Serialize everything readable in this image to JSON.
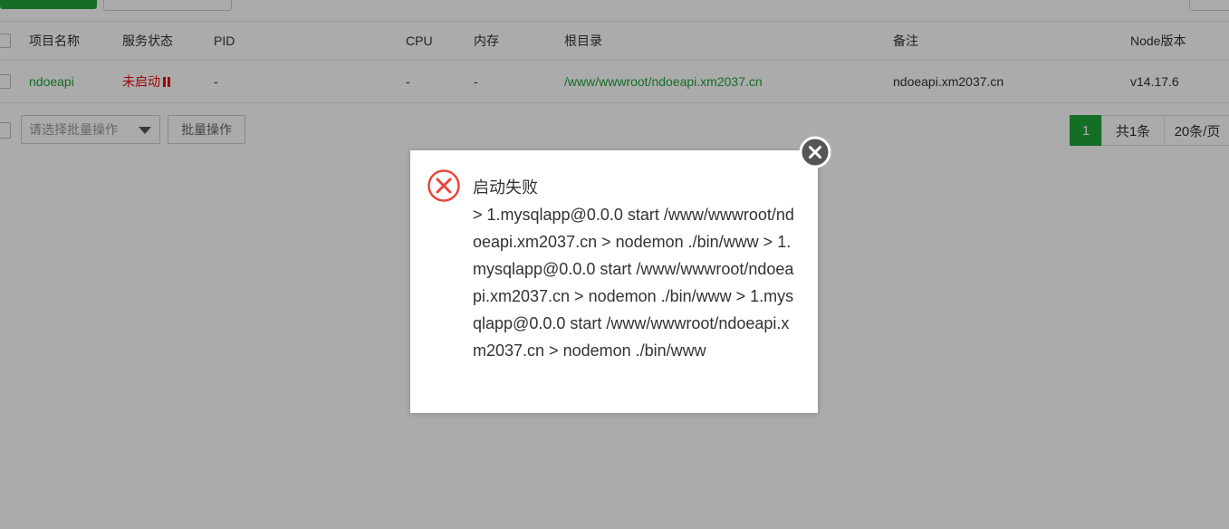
{
  "table": {
    "headers": {
      "name": "项目名称",
      "status": "服务状态",
      "pid": "PID",
      "cpu": "CPU",
      "mem": "内存",
      "root": "根目录",
      "note": "备注",
      "version": "Node版本"
    },
    "rows": [
      {
        "name": "ndoeapi",
        "status": "未启动",
        "pid": "-",
        "cpu": "-",
        "mem": "-",
        "root": "/www/wwwroot/ndoeapi.xm2037.cn",
        "note": "ndoeapi.xm2037.cn",
        "version": "v14.17.6"
      }
    ]
  },
  "toolbar": {
    "batch_select_placeholder": "请选择批量操作",
    "batch_button": "批量操作"
  },
  "pager": {
    "current": "1",
    "total": "共1条",
    "per_page": "20条/页"
  },
  "dialog": {
    "title": "启动失败",
    "message": "> 1.mysqlapp@0.0.0 start /www/wwwroot/ndoeapi.xm2037.cn > nodemon ./bin/www > 1.mysqlapp@0.0.0 start /www/wwwroot/ndoeapi.xm2037.cn > nodemon ./bin/www > 1.mysqlapp@0.0.0 start /www/wwwroot/ndoeapi.xm2037.cn > nodemon ./bin/www",
    "icon": "error-circle-icon",
    "close_icon": "close-icon"
  },
  "colors": {
    "accent": "#20a53a",
    "danger": "#ef0808",
    "error_icon": "#e8463a"
  }
}
